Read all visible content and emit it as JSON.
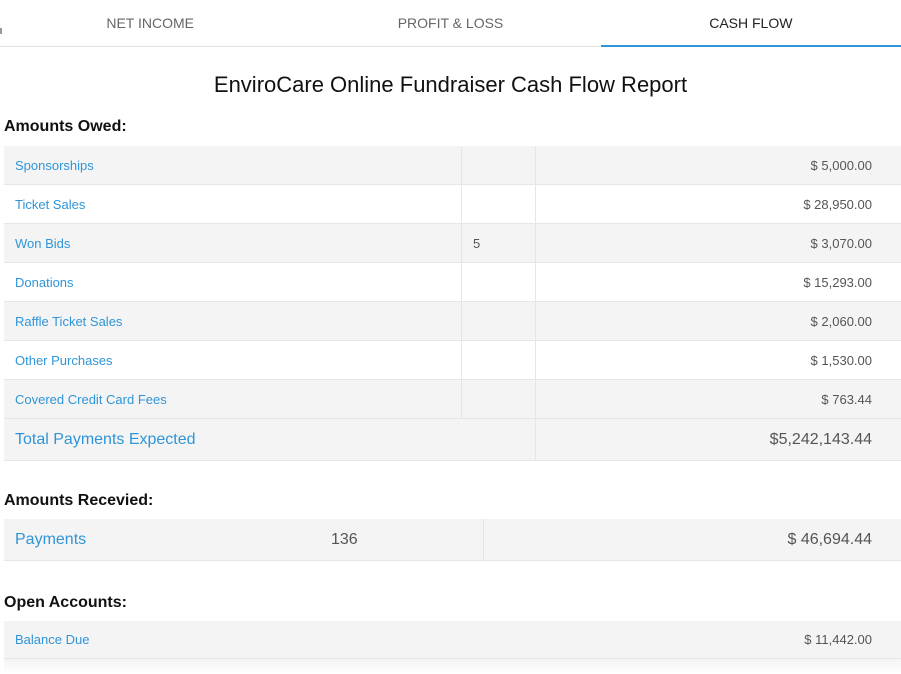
{
  "tabs": [
    {
      "label": "NET INCOME"
    },
    {
      "label": "PROFIT & LOSS"
    },
    {
      "label": "CASH FLOW"
    }
  ],
  "report_title": "EnviroCare Online Fundraiser Cash Flow Report",
  "amounts_owed": {
    "heading": "Amounts Owed:",
    "rows": [
      {
        "label": "Sponsorships",
        "count": "",
        "amount": "$ 5,000.00"
      },
      {
        "label": "Ticket Sales",
        "count": "",
        "amount": "$ 28,950.00"
      },
      {
        "label": "Won Bids",
        "count": "5",
        "amount": "$ 3,070.00"
      },
      {
        "label": "Donations",
        "count": "",
        "amount": "$ 15,293.00"
      },
      {
        "label": "Raffle Ticket Sales",
        "count": "",
        "amount": "$ 2,060.00"
      },
      {
        "label": "Other Purchases",
        "count": "",
        "amount": "$ 1,530.00"
      },
      {
        "label": "Covered Credit Card Fees",
        "count": "",
        "amount": "$ 763.44"
      }
    ],
    "total": {
      "label": "Total Payments Expected",
      "amount": "$5,242,143.44"
    }
  },
  "amounts_received": {
    "heading": "Amounts Recevied:",
    "payments": {
      "label": "Payments",
      "count": "136",
      "amount": "$ 46,694.44"
    }
  },
  "open_accounts": {
    "heading": "Open Accounts:",
    "balance_due": {
      "label": "Balance Due",
      "amount": "$ 11,442.00"
    }
  },
  "colors": {
    "accent": "#2f95d8",
    "row_alt": "#f4f4f4"
  }
}
